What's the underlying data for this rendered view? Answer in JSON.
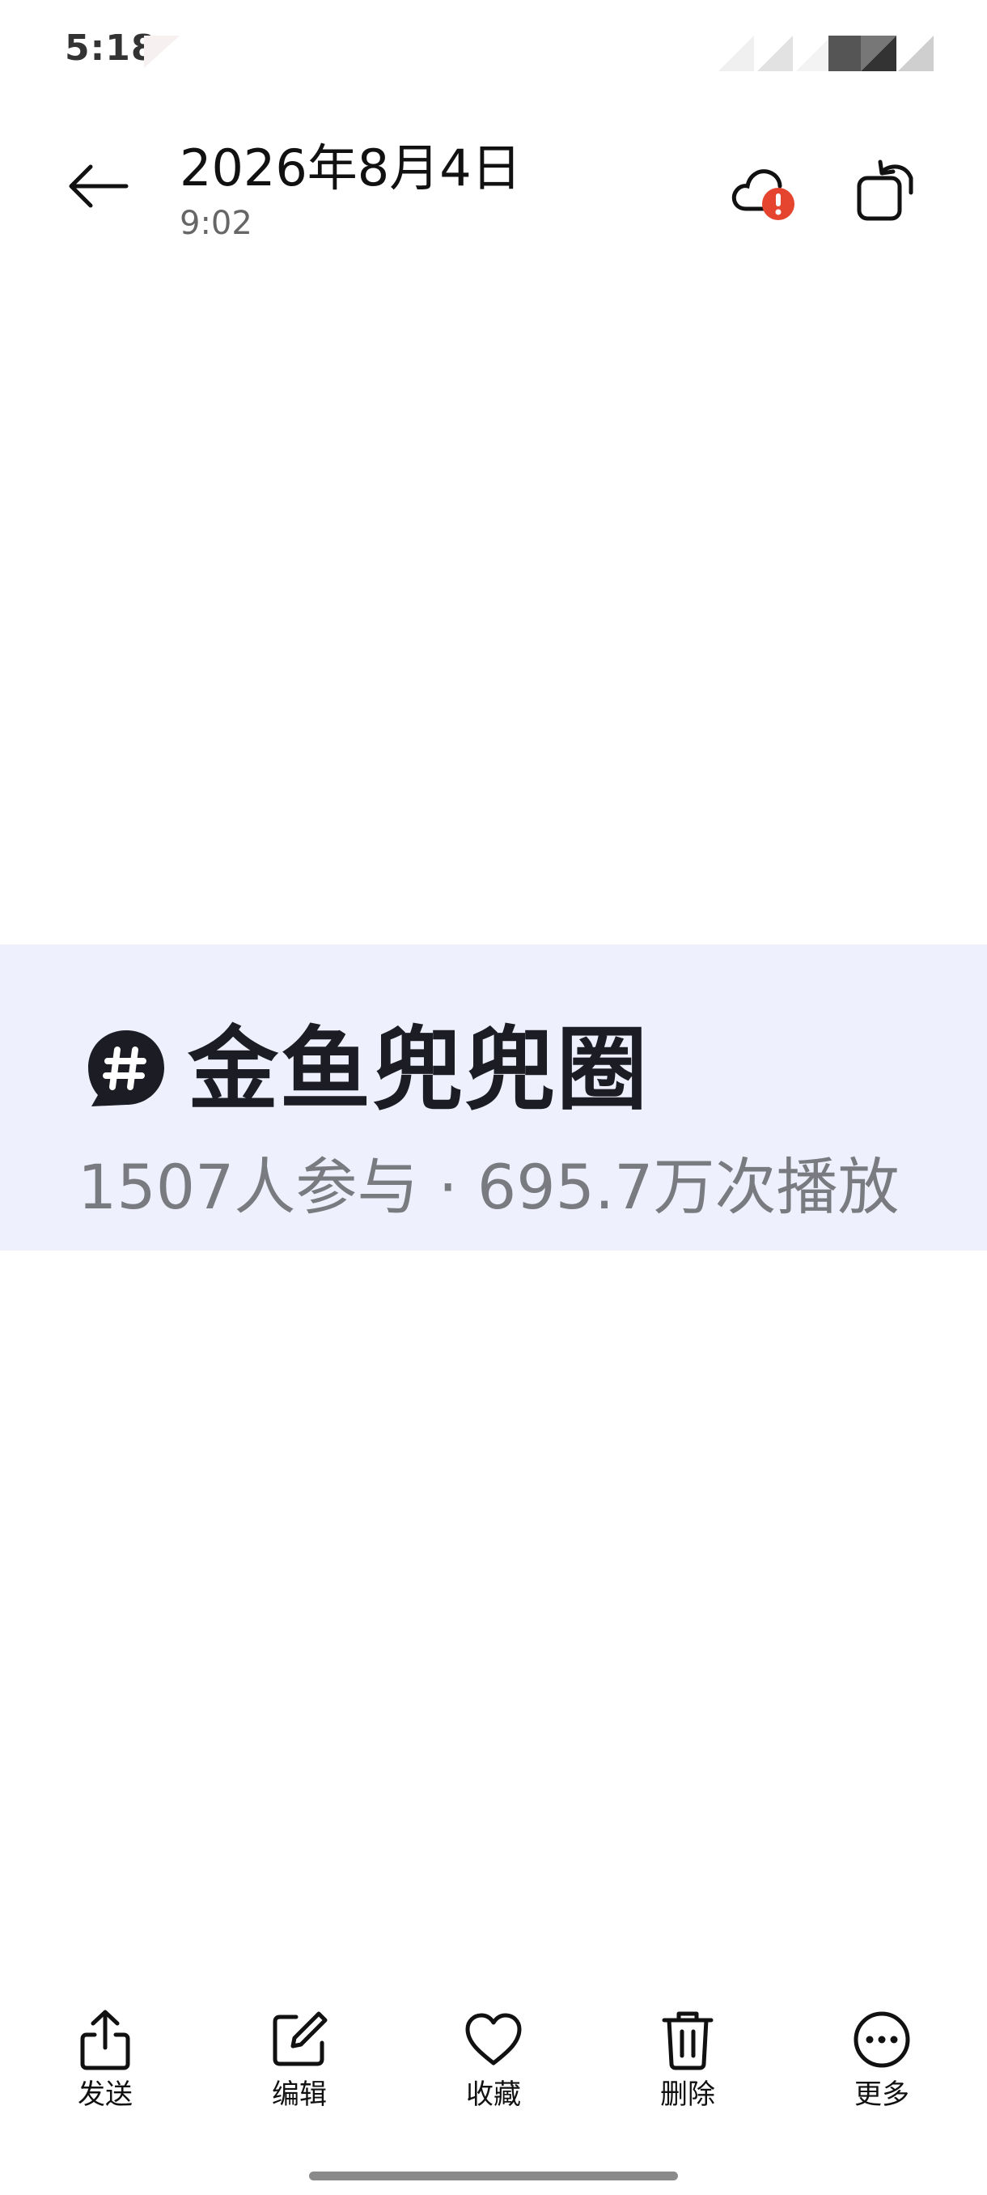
{
  "status_bar": {
    "time": "5:18"
  },
  "header": {
    "title": "2026年8月4日",
    "subtitle": "9:02",
    "back_icon": "arrow-left-icon",
    "cloud_icon": "cloud-sync-error-icon",
    "rotate_icon": "rotate-icon"
  },
  "photo": {
    "topic_icon": "hashtag-bubble-icon",
    "topic_title": "金鱼兜兜圈",
    "topic_stats": "1507人参与 · 695.7万次播放"
  },
  "toolbar": {
    "items": [
      {
        "label": "发送",
        "icon": "share-icon"
      },
      {
        "label": "编辑",
        "icon": "edit-icon"
      },
      {
        "label": "收藏",
        "icon": "heart-icon"
      },
      {
        "label": "删除",
        "icon": "trash-icon"
      },
      {
        "label": "更多",
        "icon": "more-icon"
      }
    ]
  },
  "colors": {
    "photo_background": "#eef1fd",
    "alert_red": "#e5442f",
    "text_primary": "#111111",
    "text_secondary": "#666666"
  }
}
